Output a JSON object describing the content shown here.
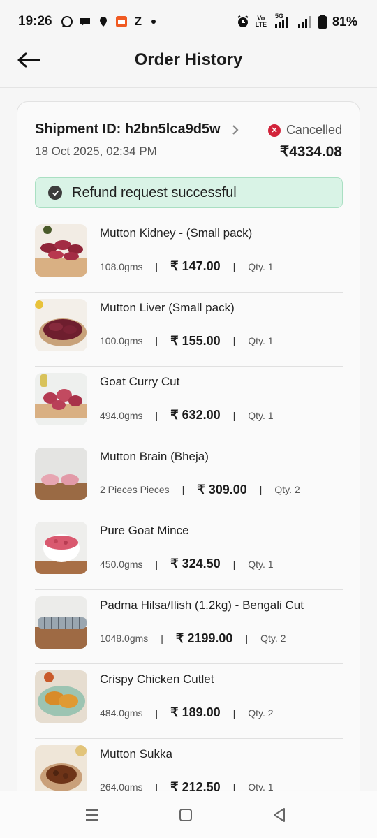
{
  "status_bar": {
    "time": "19:26",
    "battery": "81%",
    "network_top": "Vo",
    "network_bottom": "LTE",
    "gen": "5G",
    "notif_app_letter": "Z"
  },
  "header": {
    "title": "Order History"
  },
  "shipment": {
    "id_label": "Shipment ID: h2bn5lca9d5w",
    "status": "Cancelled",
    "date": "18 Oct 2025, 02:34 PM",
    "total": "₹4334.08",
    "refund_message": "Refund request successful"
  },
  "items": [
    {
      "name": "Mutton Kidney - (Small pack)",
      "weight": "108.0gms",
      "price": "₹ 147.00",
      "qty": "Qty. 1",
      "thumb": "kidney"
    },
    {
      "name": "Mutton Liver (Small pack)",
      "weight": "100.0gms",
      "price": "₹ 155.00",
      "qty": "Qty. 1",
      "thumb": "liver"
    },
    {
      "name": "Goat Curry Cut",
      "weight": "494.0gms",
      "price": "₹ 632.00",
      "qty": "Qty. 1",
      "thumb": "curry"
    },
    {
      "name": "Mutton Brain (Bheja)",
      "weight": "2 Pieces Pieces",
      "price": "₹ 309.00",
      "qty": "Qty. 2",
      "thumb": "brain"
    },
    {
      "name": "Pure Goat Mince",
      "weight": "450.0gms",
      "price": "₹ 324.50",
      "qty": "Qty. 1",
      "thumb": "mince"
    },
    {
      "name": "Padma Hilsa/Ilish (1.2kg) - Bengali Cut",
      "weight": "1048.0gms",
      "price": "₹ 2199.00",
      "qty": "Qty. 2",
      "thumb": "fish"
    },
    {
      "name": "Crispy Chicken Cutlet",
      "weight": "484.0gms",
      "price": "₹ 189.00",
      "qty": "Qty. 2",
      "thumb": "cutlet"
    },
    {
      "name": "Mutton Sukka",
      "weight": "264.0gms",
      "price": "₹ 212.50",
      "qty": "Qty. 1",
      "thumb": "sukka"
    }
  ],
  "colors": {
    "cancel_red": "#d2233a",
    "refund_bg": "#d9f3e6",
    "refund_border": "#a9dfc2"
  }
}
